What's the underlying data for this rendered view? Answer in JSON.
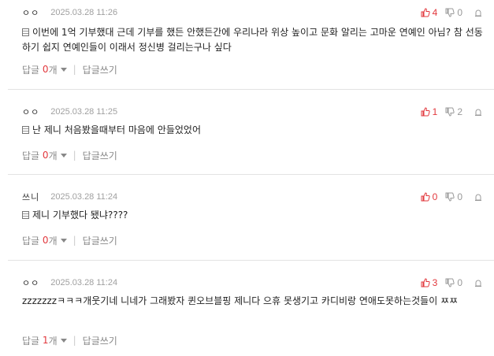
{
  "labels": {
    "reply": "답글",
    "count_unit": "개",
    "write_reply": "답글쓰기",
    "separator": "|"
  },
  "colors": {
    "accent": "#e2383d",
    "muted": "#999999",
    "divider": "#e3e3e3"
  },
  "comments": [
    {
      "author": "ㅇㅇ",
      "date": "2025.03.28 11:26",
      "up": "4",
      "down": "0",
      "text": "이번에 1억 기부했대 근데 기부를 했든 안했든간에 우리나라 위상 높이고 문화 알리는 고마운 연예인 아님? 참 선동하기 쉽지 연예인들이 이래서 정신병 걸리는구나 싶다",
      "reply_count": "0"
    },
    {
      "author": "ㅇㅇ",
      "date": "2025.03.28 11:25",
      "up": "1",
      "down": "2",
      "text": "난 제니 처음봤을때부터 마음에 안들었었어",
      "reply_count": "0"
    },
    {
      "author": "쓰니",
      "date": "2025.03.28 11:24",
      "up": "0",
      "down": "0",
      "text": "제니 기부했다 됐냐????",
      "reply_count": "0"
    },
    {
      "author": "ㅇㅇ",
      "date": "2025.03.28 11:24",
      "up": "3",
      "down": "0",
      "text": "zzzzzzzㅋㅋㅋ개웃기네 니네가 그래봤자 퀸오브블핑 제니다 으휴 못생기고 카디비랑 연애도못하는것들이 ㅉㅉ",
      "reply_count": "1"
    }
  ]
}
